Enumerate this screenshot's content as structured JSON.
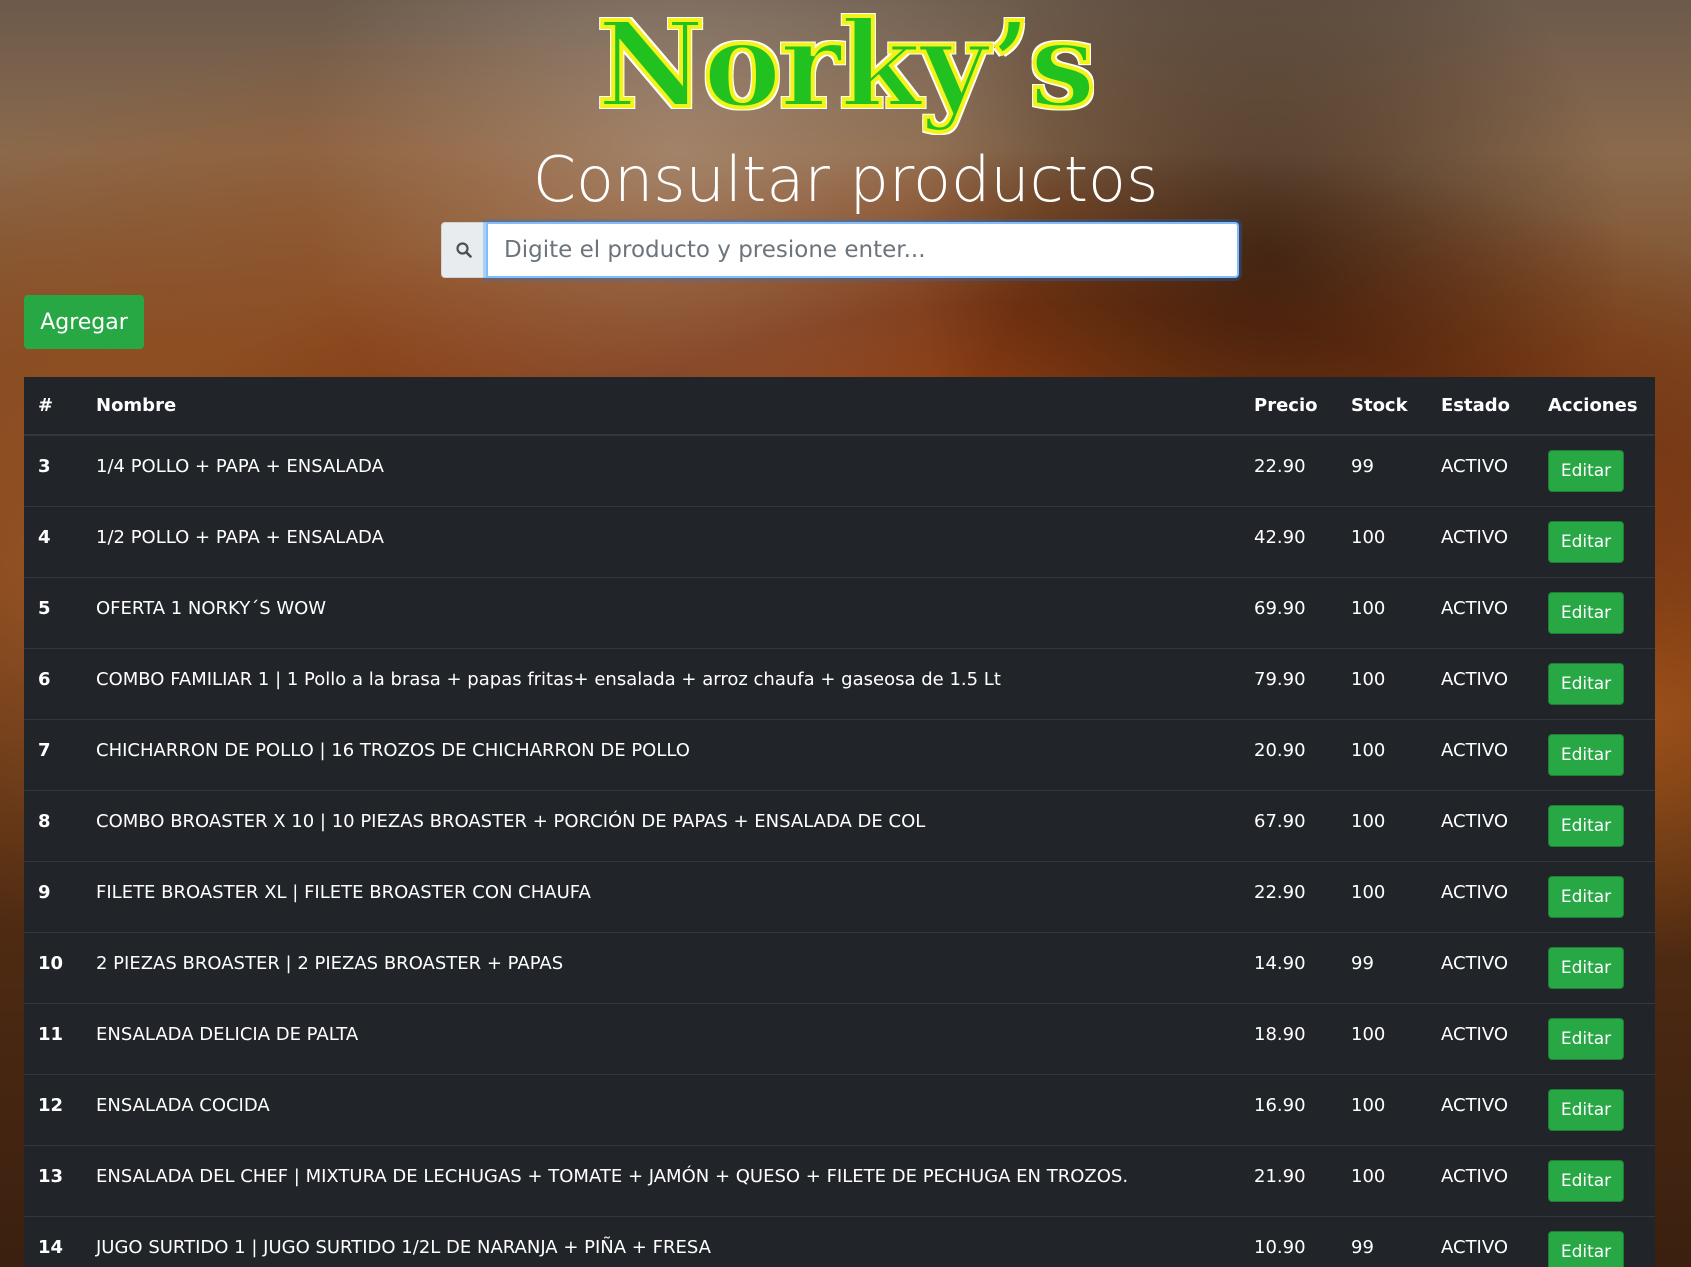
{
  "brand": {
    "logo_text": "Norky’s"
  },
  "header": {
    "title": "Consultar productos"
  },
  "search": {
    "placeholder": "Digite el producto y presione enter...",
    "value": ""
  },
  "toolbar": {
    "add_label": "Agregar"
  },
  "table": {
    "columns": [
      "#",
      "Nombre",
      "Precio",
      "Stock",
      "Estado",
      "Acciones"
    ],
    "edit_label": "Editar",
    "rows": [
      {
        "id": "3",
        "nombre": "1/4 POLLO + PAPA + ENSALADA",
        "precio": "22.90",
        "stock": "99",
        "estado": "ACTIVO"
      },
      {
        "id": "4",
        "nombre": "1/2 POLLO + PAPA + ENSALADA",
        "precio": "42.90",
        "stock": "100",
        "estado": "ACTIVO"
      },
      {
        "id": "5",
        "nombre": "OFERTA 1 NORKY´S WOW",
        "precio": "69.90",
        "stock": "100",
        "estado": "ACTIVO"
      },
      {
        "id": "6",
        "nombre": "COMBO FAMILIAR 1 | 1 Pollo a la brasa + papas fritas+ ensalada + arroz chaufa + gaseosa de 1.5 Lt",
        "precio": "79.90",
        "stock": "100",
        "estado": "ACTIVO"
      },
      {
        "id": "7",
        "nombre": "CHICHARRON DE POLLO | 16 TROZOS DE CHICHARRON DE POLLO",
        "precio": "20.90",
        "stock": "100",
        "estado": "ACTIVO"
      },
      {
        "id": "8",
        "nombre": "COMBO BROASTER X 10 | 10 PIEZAS BROASTER + PORCIÓN DE PAPAS + ENSALADA DE COL",
        "precio": "67.90",
        "stock": "100",
        "estado": "ACTIVO"
      },
      {
        "id": "9",
        "nombre": "FILETE BROASTER XL | FILETE BROASTER CON CHAUFA",
        "precio": "22.90",
        "stock": "100",
        "estado": "ACTIVO"
      },
      {
        "id": "10",
        "nombre": "2 PIEZAS BROASTER | 2 PIEZAS BROASTER + PAPAS",
        "precio": "14.90",
        "stock": "99",
        "estado": "ACTIVO"
      },
      {
        "id": "11",
        "nombre": "ENSALADA DELICIA DE PALTA",
        "precio": "18.90",
        "stock": "100",
        "estado": "ACTIVO"
      },
      {
        "id": "12",
        "nombre": "ENSALADA COCIDA",
        "precio": "16.90",
        "stock": "100",
        "estado": "ACTIVO"
      },
      {
        "id": "13",
        "nombre": "ENSALADA DEL CHEF | MIXTURA DE LECHUGAS + TOMATE + JAMÓN + QUESO + FILETE DE PECHUGA EN TROZOS.",
        "precio": "21.90",
        "stock": "100",
        "estado": "ACTIVO"
      },
      {
        "id": "14",
        "nombre": "JUGO SURTIDO 1 | JUGO SURTIDO 1/2L DE NARANJA + PIÑA + FRESA",
        "precio": "10.90",
        "stock": "99",
        "estado": "ACTIVO"
      }
    ]
  },
  "colors": {
    "accent_green": "#28a745",
    "table_bg": "#212529",
    "logo_green": "#21c21f",
    "logo_outline": "#f4f21b"
  },
  "icons": {
    "search": "search-icon"
  }
}
